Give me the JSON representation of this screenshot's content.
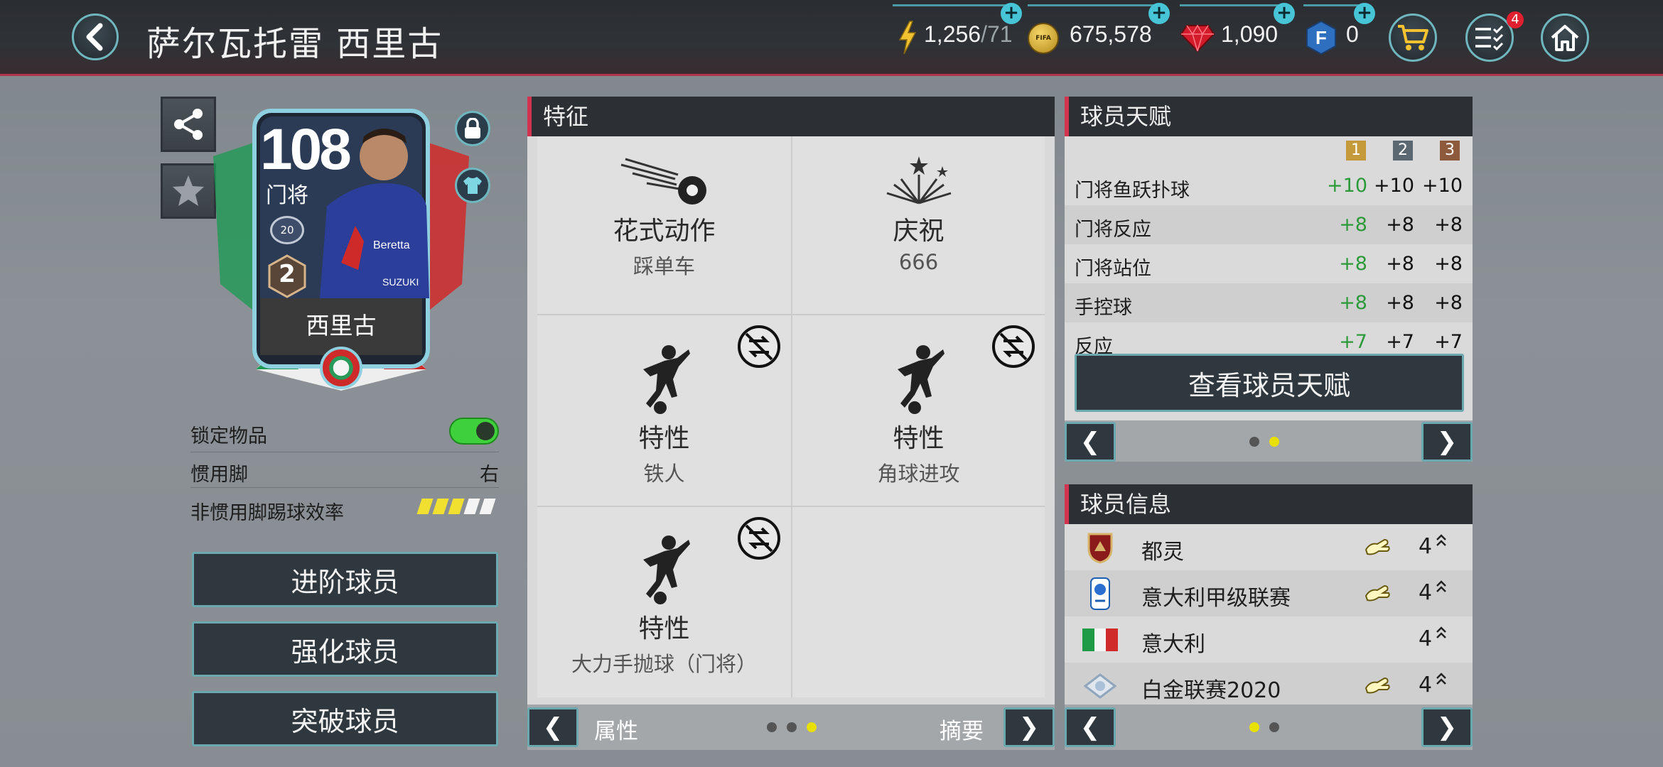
{
  "header": {
    "title": "萨尔瓦托雷 西里古",
    "stamina": {
      "value": "1,256",
      "max": "/71"
    },
    "coins": "675,578",
    "gems": "1,090",
    "fifa_points": "0",
    "notification_badge": "4",
    "coin_icon_text": "FIFA"
  },
  "card": {
    "rating": "108",
    "position": "门将",
    "level_badge": "20",
    "rank_badge": "2",
    "name": "西里古"
  },
  "left_panel": {
    "lock_label": "锁定物品",
    "lock_on": true,
    "foot_label": "惯用脚",
    "foot_value": "右",
    "weak_foot_label": "非惯用脚踢球效率",
    "weak_foot_stars": 3,
    "weak_foot_max": 5,
    "buttons": [
      "进阶球员",
      "强化球员",
      "突破球员"
    ]
  },
  "traits": {
    "title": "特征",
    "cells": [
      {
        "title": "花式动作",
        "sub": "踩单车",
        "icon": "skill-move-ball-icon"
      },
      {
        "title": "庆祝",
        "sub": "666",
        "icon": "celebration-fireworks-icon"
      },
      {
        "title": "特性",
        "sub": "铁人",
        "icon": "trait-player-icon",
        "swap": true
      },
      {
        "title": "特性",
        "sub": "角球进攻",
        "icon": "trait-player-icon",
        "swap": true
      },
      {
        "title": "特性",
        "sub": "大力手抛球（门将）",
        "icon": "trait-player-icon",
        "swap": true
      }
    ],
    "nav": {
      "left": "属性",
      "right": "摘要",
      "prev": "❮",
      "next": "❯"
    }
  },
  "skills": {
    "title": "球员天赋",
    "columns": [
      "1",
      "2",
      "3"
    ],
    "column_colors": [
      "#c59a3a",
      "#5b6872",
      "#8e5a3e"
    ],
    "rows": [
      {
        "name": "门将鱼跃扑球",
        "v1": "+10",
        "v2": "+10",
        "v3": "+10"
      },
      {
        "name": "门将反应",
        "v1": "+8",
        "v2": "+8",
        "v3": "+8"
      },
      {
        "name": "门将站位",
        "v1": "+8",
        "v2": "+8",
        "v3": "+8"
      },
      {
        "name": "手控球",
        "v1": "+8",
        "v2": "+8",
        "v3": "+8"
      },
      {
        "name": "反应",
        "v1": "+7",
        "v2": "+7",
        "v3": "+7"
      }
    ],
    "view_button": "查看球员天赋",
    "prev": "❮",
    "next": "❯"
  },
  "info": {
    "title": "球员信息",
    "rows": [
      {
        "name": "都灵",
        "value": "4",
        "icon": "torino-crest-icon",
        "hand": true
      },
      {
        "name": "意大利甲级联赛",
        "value": "4",
        "icon": "serie-a-logo-icon",
        "hand": true
      },
      {
        "name": "意大利",
        "value": "4",
        "icon": "italy-flag-icon",
        "hand": false
      },
      {
        "name": "白金联赛2020",
        "value": "4",
        "icon": "platinum-league-icon",
        "hand": true
      }
    ],
    "prev": "❮",
    "next": "❯"
  }
}
